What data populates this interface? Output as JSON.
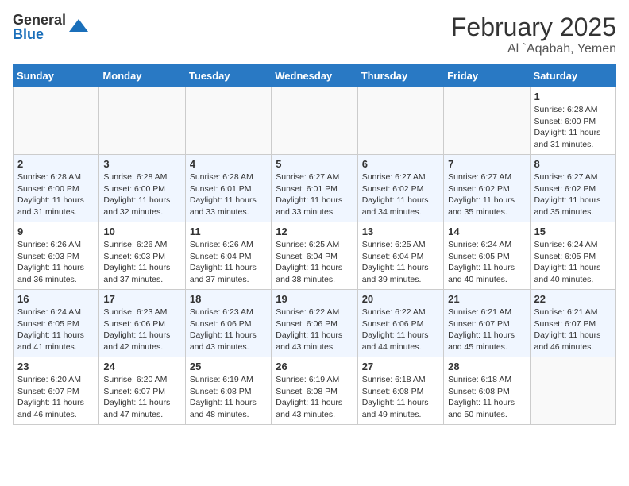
{
  "logo": {
    "general": "General",
    "blue": "Blue"
  },
  "title": "February 2025",
  "location": "Al `Aqabah, Yemen",
  "days_of_week": [
    "Sunday",
    "Monday",
    "Tuesday",
    "Wednesday",
    "Thursday",
    "Friday",
    "Saturday"
  ],
  "weeks": [
    [
      {
        "day": "",
        "info": ""
      },
      {
        "day": "",
        "info": ""
      },
      {
        "day": "",
        "info": ""
      },
      {
        "day": "",
        "info": ""
      },
      {
        "day": "",
        "info": ""
      },
      {
        "day": "",
        "info": ""
      },
      {
        "day": "1",
        "info": "Sunrise: 6:28 AM\nSunset: 6:00 PM\nDaylight: 11 hours\nand 31 minutes."
      }
    ],
    [
      {
        "day": "2",
        "info": "Sunrise: 6:28 AM\nSunset: 6:00 PM\nDaylight: 11 hours\nand 31 minutes."
      },
      {
        "day": "3",
        "info": "Sunrise: 6:28 AM\nSunset: 6:00 PM\nDaylight: 11 hours\nand 32 minutes."
      },
      {
        "day": "4",
        "info": "Sunrise: 6:28 AM\nSunset: 6:01 PM\nDaylight: 11 hours\nand 33 minutes."
      },
      {
        "day": "5",
        "info": "Sunrise: 6:27 AM\nSunset: 6:01 PM\nDaylight: 11 hours\nand 33 minutes."
      },
      {
        "day": "6",
        "info": "Sunrise: 6:27 AM\nSunset: 6:02 PM\nDaylight: 11 hours\nand 34 minutes."
      },
      {
        "day": "7",
        "info": "Sunrise: 6:27 AM\nSunset: 6:02 PM\nDaylight: 11 hours\nand 35 minutes."
      },
      {
        "day": "8",
        "info": "Sunrise: 6:27 AM\nSunset: 6:02 PM\nDaylight: 11 hours\nand 35 minutes."
      }
    ],
    [
      {
        "day": "9",
        "info": "Sunrise: 6:26 AM\nSunset: 6:03 PM\nDaylight: 11 hours\nand 36 minutes."
      },
      {
        "day": "10",
        "info": "Sunrise: 6:26 AM\nSunset: 6:03 PM\nDaylight: 11 hours\nand 37 minutes."
      },
      {
        "day": "11",
        "info": "Sunrise: 6:26 AM\nSunset: 6:04 PM\nDaylight: 11 hours\nand 37 minutes."
      },
      {
        "day": "12",
        "info": "Sunrise: 6:25 AM\nSunset: 6:04 PM\nDaylight: 11 hours\nand 38 minutes."
      },
      {
        "day": "13",
        "info": "Sunrise: 6:25 AM\nSunset: 6:04 PM\nDaylight: 11 hours\nand 39 minutes."
      },
      {
        "day": "14",
        "info": "Sunrise: 6:24 AM\nSunset: 6:05 PM\nDaylight: 11 hours\nand 40 minutes."
      },
      {
        "day": "15",
        "info": "Sunrise: 6:24 AM\nSunset: 6:05 PM\nDaylight: 11 hours\nand 40 minutes."
      }
    ],
    [
      {
        "day": "16",
        "info": "Sunrise: 6:24 AM\nSunset: 6:05 PM\nDaylight: 11 hours\nand 41 minutes."
      },
      {
        "day": "17",
        "info": "Sunrise: 6:23 AM\nSunset: 6:06 PM\nDaylight: 11 hours\nand 42 minutes."
      },
      {
        "day": "18",
        "info": "Sunrise: 6:23 AM\nSunset: 6:06 PM\nDaylight: 11 hours\nand 43 minutes."
      },
      {
        "day": "19",
        "info": "Sunrise: 6:22 AM\nSunset: 6:06 PM\nDaylight: 11 hours\nand 43 minutes."
      },
      {
        "day": "20",
        "info": "Sunrise: 6:22 AM\nSunset: 6:06 PM\nDaylight: 11 hours\nand 44 minutes."
      },
      {
        "day": "21",
        "info": "Sunrise: 6:21 AM\nSunset: 6:07 PM\nDaylight: 11 hours\nand 45 minutes."
      },
      {
        "day": "22",
        "info": "Sunrise: 6:21 AM\nSunset: 6:07 PM\nDaylight: 11 hours\nand 46 minutes."
      }
    ],
    [
      {
        "day": "23",
        "info": "Sunrise: 6:20 AM\nSunset: 6:07 PM\nDaylight: 11 hours\nand 46 minutes."
      },
      {
        "day": "24",
        "info": "Sunrise: 6:20 AM\nSunset: 6:07 PM\nDaylight: 11 hours\nand 47 minutes."
      },
      {
        "day": "25",
        "info": "Sunrise: 6:19 AM\nSunset: 6:08 PM\nDaylight: 11 hours\nand 48 minutes."
      },
      {
        "day": "26",
        "info": "Sunrise: 6:19 AM\nSunset: 6:08 PM\nDaylight: 11 hours\nand 43 minutes."
      },
      {
        "day": "27",
        "info": "Sunrise: 6:18 AM\nSunset: 6:08 PM\nDaylight: 11 hours\nand 49 minutes."
      },
      {
        "day": "28",
        "info": "Sunrise: 6:18 AM\nSunset: 6:08 PM\nDaylight: 11 hours\nand 50 minutes."
      },
      {
        "day": "",
        "info": ""
      }
    ]
  ]
}
